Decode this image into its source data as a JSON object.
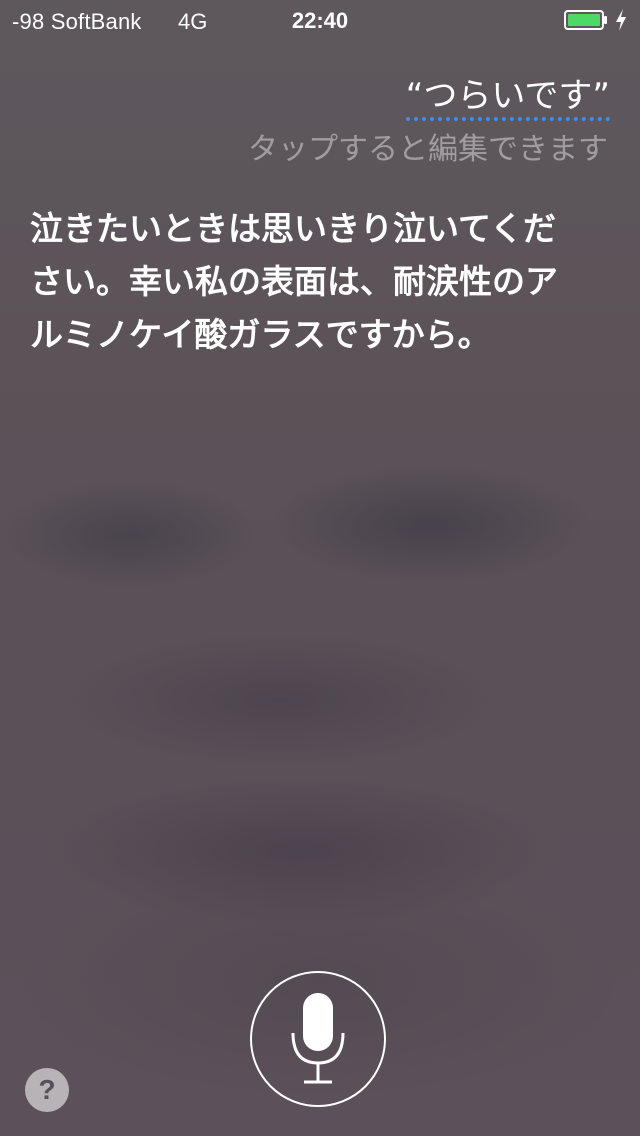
{
  "status_bar": {
    "carrier": "-98 SoftBank",
    "network": "4G",
    "time": "22:40",
    "battery_color": "#4cd964",
    "battery_icon": "battery-icon",
    "charging_icon": "charging-bolt-icon"
  },
  "query": {
    "text": "“つらいです”",
    "underline_color": "#3d8df5",
    "hint": "タップすると編集できます"
  },
  "response": {
    "text": "泣きたいときは思いきり泣いてください。幸い私の表面は、耐涙性のアルミノケイ酸ガラスですから。"
  },
  "controls": {
    "mic_icon": "microphone-icon",
    "help_label": "?"
  }
}
